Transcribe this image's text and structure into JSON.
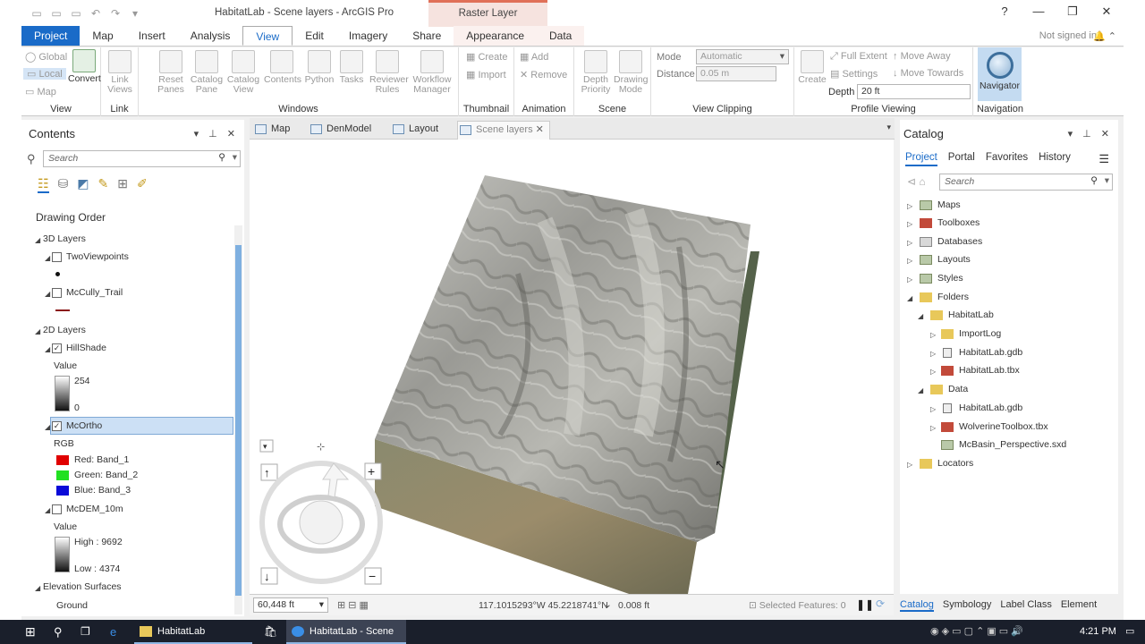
{
  "titlebar": {
    "title": "HabitatLab - Scene layers - ArcGIS Pro",
    "context_tab": "Raster Layer",
    "help": "?",
    "minimize": "—",
    "maximize": "❐",
    "close": "✕"
  },
  "ribbon_tabs": [
    "Project",
    "Map",
    "Insert",
    "Analysis",
    "View",
    "Edit",
    "Imagery",
    "Share",
    "Appearance",
    "Data"
  ],
  "account": {
    "signin": "Not signed in"
  },
  "ribbon": {
    "view": {
      "global": "Global",
      "local": "Local",
      "map": "Map",
      "convert": "Convert",
      "label": "View"
    },
    "link": {
      "link_views": "Link Views",
      "label": "Link"
    },
    "windows": {
      "reset_panes": "Reset Panes",
      "catalog_pane": "Catalog Pane",
      "catalog_view": "Catalog View",
      "contents": "Contents",
      "python": "Python",
      "tasks": "Tasks",
      "reviewer_rules": "Reviewer Rules",
      "workflow_manager": "Workflow Manager",
      "label": "Windows"
    },
    "thumbnail": {
      "create": "Create",
      "import": "Import",
      "label": "Thumbnail"
    },
    "animation": {
      "add": "Add",
      "remove": "Remove",
      "label": "Animation"
    },
    "scene": {
      "depth_priority": "Depth Priority",
      "drawing_mode": "Drawing Mode",
      "label": "Scene"
    },
    "view_clipping": {
      "mode_label": "Mode",
      "mode_value": "Automatic",
      "distance_label": "Distance",
      "distance_value": "0.05 m",
      "label": "View Clipping"
    },
    "profile_viewing": {
      "create": "Create",
      "full_extent": "Full Extent",
      "settings": "Settings",
      "move_away": "Move Away",
      "move_towards": "Move Towards",
      "depth_label": "Depth",
      "depth_value": "20 ft",
      "label": "Profile Viewing"
    },
    "navigation": {
      "navigator": "Navigator",
      "label": "Navigation"
    }
  },
  "contents": {
    "title": "Contents",
    "search_placeholder": "Search",
    "drawing_order": "Drawing Order",
    "group_3d": "3D Layers",
    "two_viewpoints": "TwoViewpoints",
    "mccully_trail": "McCully_Trail",
    "group_2d": "2D Layers",
    "hillshade": "HillShade",
    "value_label": "Value",
    "hs_high": "254",
    "hs_low": "0",
    "mcortho": "McOrtho",
    "rgb": "RGB",
    "red": "Red:   Band_1",
    "green": "Green:  Band_2",
    "blue": "Blue:  Band_3",
    "mcdem": "McDEM_10m",
    "dem_value": "Value",
    "dem_high": "High : 9692",
    "dem_low": "Low : 4374",
    "elevation": "Elevation Surfaces",
    "ground": "Ground"
  },
  "view_tabs": [
    "Map",
    "DenModel",
    "Layout",
    "Scene layers"
  ],
  "status": {
    "scale": "60,448 ft",
    "coords": "117.1015293°W 45.2218741°N",
    "elev": "0.008 ft",
    "selected": "Selected Features: 0"
  },
  "catalog": {
    "title": "Catalog",
    "tabs": [
      "Project",
      "Portal",
      "Favorites",
      "History"
    ],
    "search_placeholder": "Search",
    "items": {
      "maps": "Maps",
      "toolboxes": "Toolboxes",
      "databases": "Databases",
      "layouts": "Layouts",
      "styles": "Styles",
      "folders": "Folders",
      "habitatlab": "HabitatLab",
      "importlog": "ImportLog",
      "hl_gdb": "HabitatLab.gdb",
      "hl_tbx": "HabitatLab.tbx",
      "data": "Data",
      "data_gdb": "HabitatLab.gdb",
      "wolverine": "WolverineToolbox.tbx",
      "mcbasin": "McBasin_Perspective.sxd",
      "locators": "Locators"
    },
    "bottom_tabs": [
      "Catalog",
      "Symbology",
      "Label Class",
      "Element"
    ]
  },
  "taskbar": {
    "apps": [
      "HabitatLab",
      "HabitatLab - Scene la..."
    ],
    "time": "4:21 PM"
  },
  "colors": {
    "accent": "#1a6bc8",
    "context": "#e07058",
    "selection": "#cce0f5"
  }
}
